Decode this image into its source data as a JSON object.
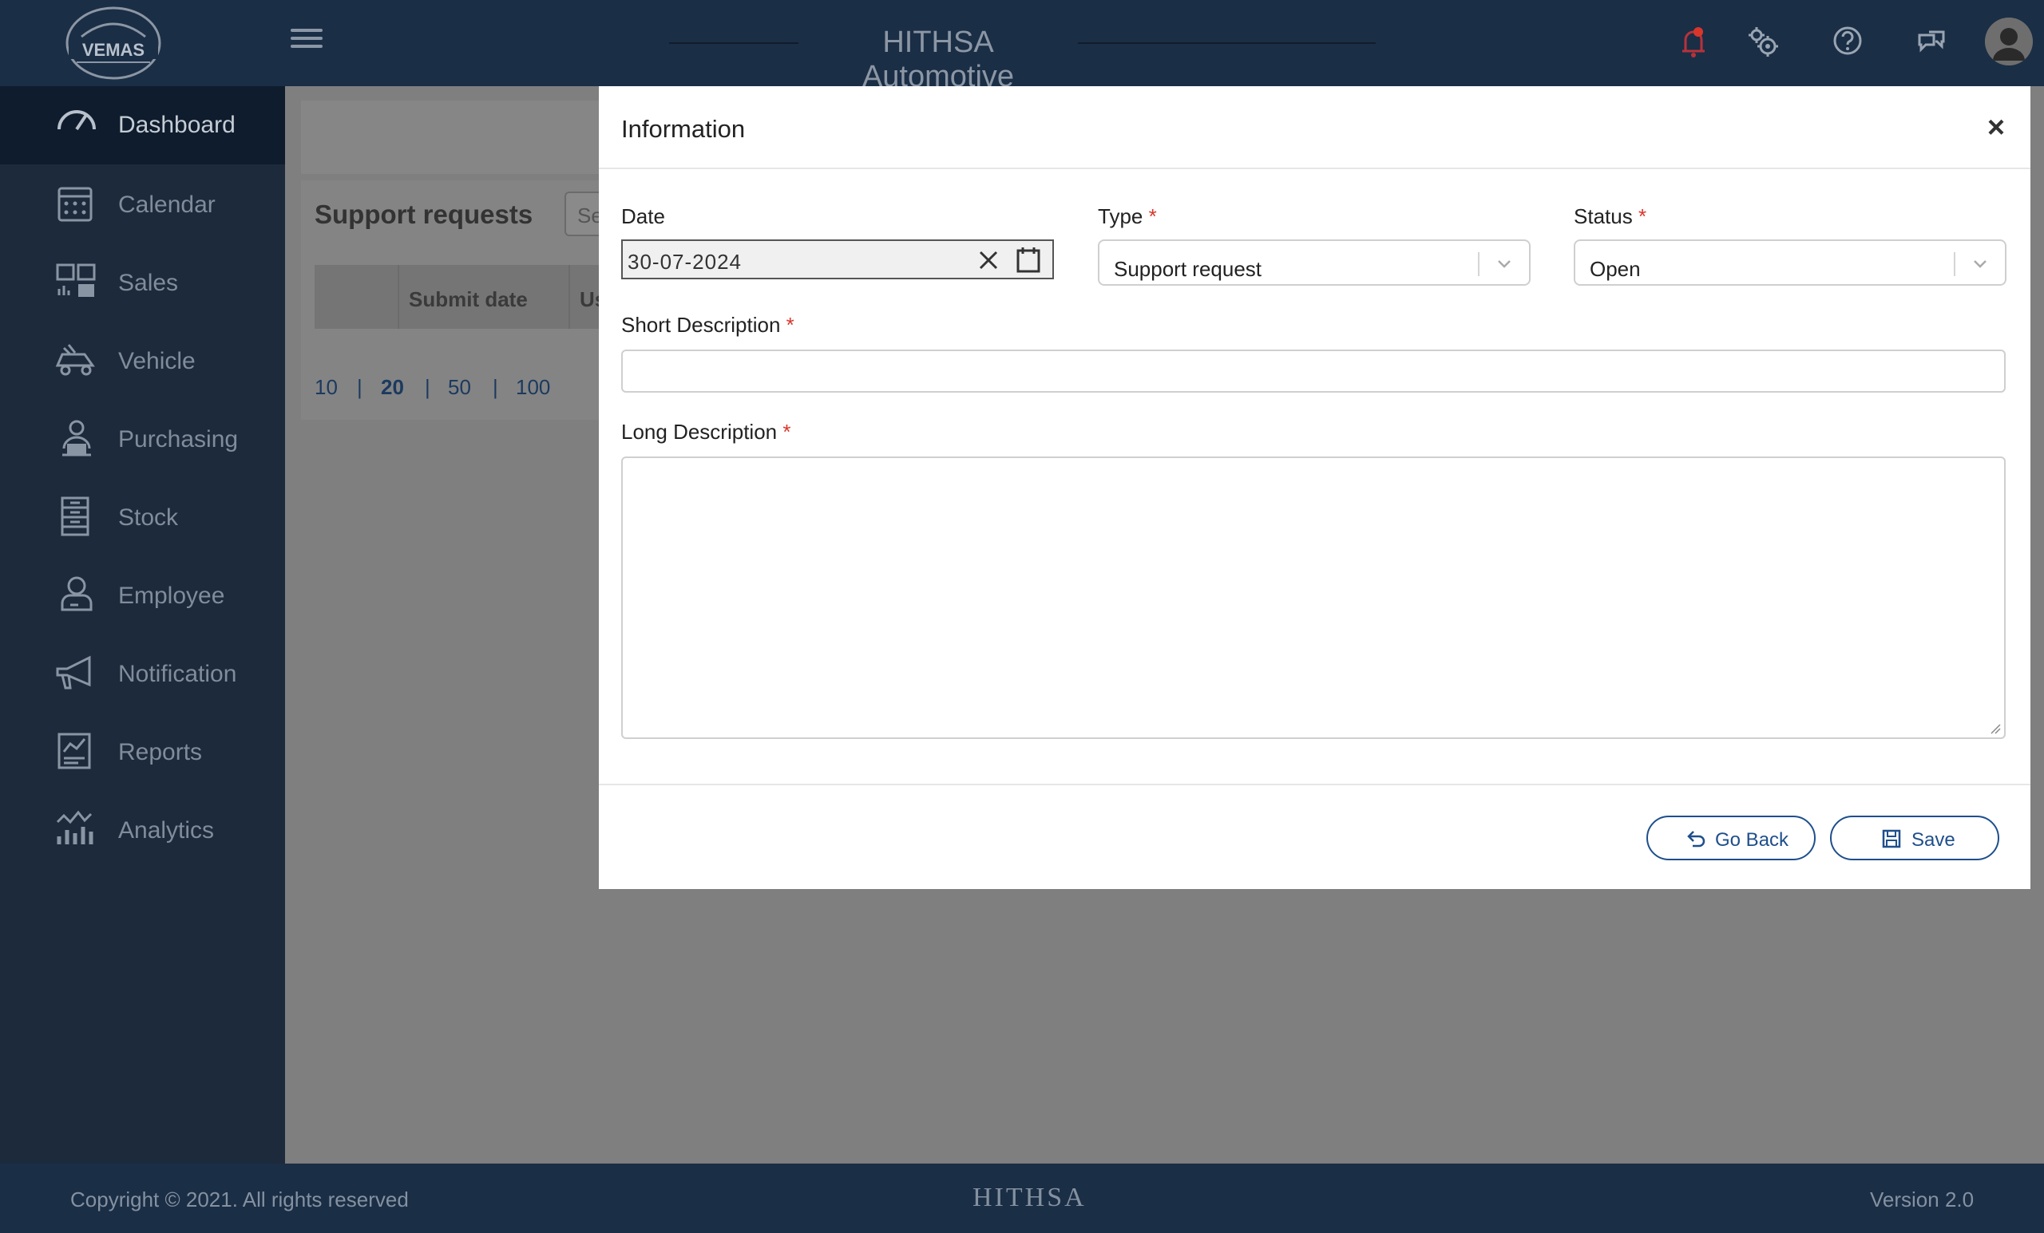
{
  "header": {
    "logo_text": "VEMAS",
    "app_title": "HITHSA Automotive",
    "icons": [
      "bell-icon",
      "gears-icon",
      "help-icon",
      "support-chat-icon",
      "user-avatar"
    ],
    "notification_color": "#d9362b"
  },
  "sidebar": {
    "items": [
      {
        "label": "Dashboard",
        "icon": "speedometer-icon",
        "active": true
      },
      {
        "label": "Calendar",
        "icon": "calendar-icon"
      },
      {
        "label": "Sales",
        "icon": "sales-icon"
      },
      {
        "label": "Vehicle",
        "icon": "vehicle-icon"
      },
      {
        "label": "Purchasing",
        "icon": "purchasing-icon"
      },
      {
        "label": "Stock",
        "icon": "stock-icon"
      },
      {
        "label": "Employee",
        "icon": "employee-icon"
      },
      {
        "label": "Notification",
        "icon": "megaphone-icon"
      },
      {
        "label": "Reports",
        "icon": "reports-icon"
      },
      {
        "label": "Analytics",
        "icon": "analytics-icon"
      }
    ]
  },
  "page": {
    "title": "Support requests",
    "search_placeholder": "Se",
    "columns": [
      "",
      "Submit date",
      "Us"
    ],
    "page_sizes": [
      "10",
      "20",
      "50",
      "100"
    ],
    "current_page_size": "20"
  },
  "modal": {
    "title": "Information",
    "date_label": "Date",
    "date_value": "30-07-2024",
    "type_label": "Type",
    "type_value": "Support request",
    "status_label": "Status",
    "status_value": "Open",
    "short_desc_label": "Short Description",
    "short_desc_value": "",
    "long_desc_label": "Long Description",
    "long_desc_value": "",
    "required_mark": "*",
    "go_back_label": "Go Back",
    "save_label": "Save",
    "accent_color": "#1e4f8c"
  },
  "footer": {
    "copyright": "Copyright © 2021. All rights reserved",
    "brand": "HITHSA",
    "version": "Version 2.0"
  }
}
